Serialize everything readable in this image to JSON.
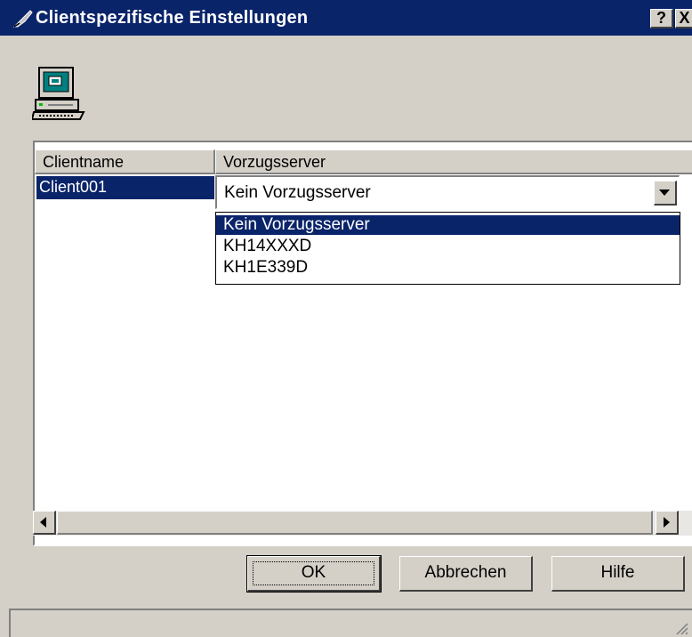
{
  "window": {
    "title": "Clientspezifische Einstellungen",
    "help_label": "?",
    "close_label": "X",
    "title_icon": "feather-pen-icon"
  },
  "client_icon": "computer-terminal-icon",
  "listview": {
    "columns": [
      "Clientname",
      "Vorzugsserver"
    ],
    "rows": [
      {
        "client": "Client001",
        "server": "Kein Vorzugsserver"
      }
    ]
  },
  "combo": {
    "value": "Kein Vorzugsserver",
    "options": [
      "Kein Vorzugsserver",
      "KH14XXXD",
      "KH1E339D"
    ],
    "selected_index": 0
  },
  "buttons": {
    "ok": "OK",
    "cancel": "Abbrechen",
    "help": "Hilfe"
  },
  "colors": {
    "title_bar": "#0a246a",
    "face": "#d4d0c8",
    "selection": "#0a246a"
  }
}
